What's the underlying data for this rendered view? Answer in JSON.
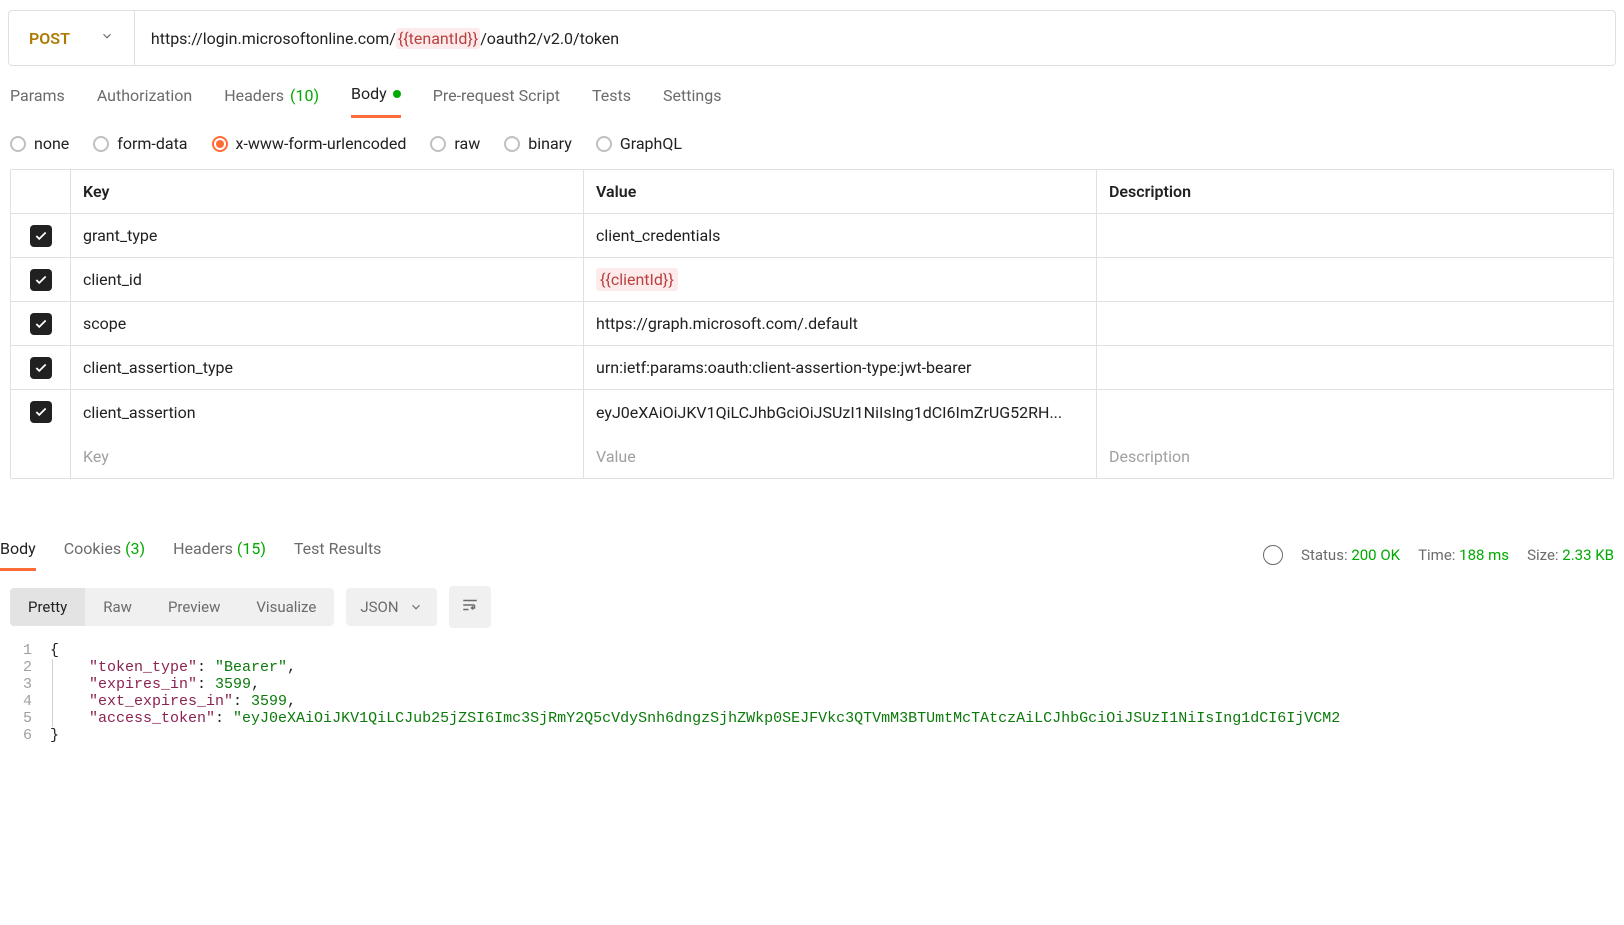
{
  "request": {
    "method": "POST",
    "url_prefix": "https://login.microsoftonline.com/",
    "url_variable": "{{tenantId}}",
    "url_suffix": "/oauth2/v2.0/token"
  },
  "request_tabs": {
    "params": "Params",
    "authorization": "Authorization",
    "headers": "Headers",
    "headers_count": "(10)",
    "body": "Body",
    "pre_request": "Pre-request Script",
    "tests": "Tests",
    "settings": "Settings"
  },
  "body_types": {
    "none": "none",
    "form_data": "form-data",
    "urlencoded": "x-www-form-urlencoded",
    "raw": "raw",
    "binary": "binary",
    "graphql": "GraphQL"
  },
  "kv_headers": {
    "key": "Key",
    "value": "Value",
    "description": "Description"
  },
  "body_rows": [
    {
      "key": "grant_type",
      "value": "client_credentials",
      "is_var": false
    },
    {
      "key": "client_id",
      "value": "{{clientId}}",
      "is_var": true
    },
    {
      "key": "scope",
      "value": "https://graph.microsoft.com/.default",
      "is_var": false
    },
    {
      "key": "client_assertion_type",
      "value": "urn:ietf:params:oauth:client-assertion-type:jwt-bearer",
      "is_var": false
    },
    {
      "key": "client_assertion",
      "value": "eyJ0eXAiOiJKV1QiLCJhbGciOiJSUzI1NiIsIng1dCI6ImZrUG52RH...",
      "is_var": false
    }
  ],
  "kv_placeholders": {
    "key": "Key",
    "value": "Value",
    "description": "Description"
  },
  "response_tabs": {
    "body": "Body",
    "cookies": "Cookies",
    "cookies_count": "(3)",
    "headers": "Headers",
    "headers_count": "(15)",
    "test_results": "Test Results"
  },
  "response_meta": {
    "status_label": "Status:",
    "status_value": "200 OK",
    "time_label": "Time:",
    "time_value": "188 ms",
    "size_label": "Size:",
    "size_value": "2.33 KB"
  },
  "view_modes": {
    "pretty": "Pretty",
    "raw": "Raw",
    "preview": "Preview",
    "visualize": "Visualize"
  },
  "format": "JSON",
  "response_json": {
    "l1": "{",
    "l2_key": "\"token_type\"",
    "l2_val": "\"Bearer\"",
    "l3_key": "\"expires_in\"",
    "l3_val": "3599",
    "l4_key": "\"ext_expires_in\"",
    "l4_val": "3599",
    "l5_key": "\"access_token\"",
    "l5_val": "\"eyJ0eXAiOiJKV1QiLCJub25jZSI6Imc3SjRmY2Q5cVdySnh6dngzSjhZWkp0SEJFVkc3QTVmM3BTUmtMcTAtczAiLCJhbGciOiJSUzI1NiIsIng1dCI6IjVCM2",
    "l6": "}"
  }
}
